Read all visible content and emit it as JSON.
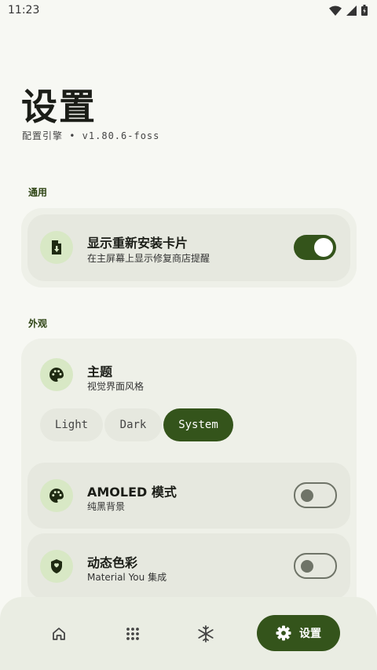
{
  "status": {
    "time": "11:23"
  },
  "header": {
    "title": "设置",
    "subtitle": "配置引擎 • v1.80.6-foss"
  },
  "sections": {
    "general": {
      "label": "通用",
      "reinstall": {
        "icon": "file-download-icon",
        "title": "显示重新安装卡片",
        "subtitle": "在主屏幕上显示修复商店提醒",
        "enabled": true
      }
    },
    "appearance": {
      "label": "外观",
      "theme": {
        "icon": "palette-icon",
        "title": "主题",
        "subtitle": "视觉界面风格",
        "options": [
          "Light",
          "Dark",
          "System"
        ],
        "selected": "System"
      },
      "amoled": {
        "icon": "palette-icon",
        "title": "AMOLED 模式",
        "subtitle": "纯黑背景",
        "enabled": false
      },
      "dynamic": {
        "icon": "shield-icon",
        "title": "动态色彩",
        "subtitle": "Material You 集成",
        "enabled": false
      }
    }
  },
  "nav": {
    "items": [
      {
        "icon": "home-icon"
      },
      {
        "icon": "apps-grid-icon"
      },
      {
        "icon": "snowflake-icon"
      }
    ],
    "active": {
      "icon": "gear-icon",
      "label": "设置"
    }
  },
  "colors": {
    "accent": "#34541b",
    "icon_bg": "#d8e8c5",
    "background": "#f7f8f3"
  }
}
